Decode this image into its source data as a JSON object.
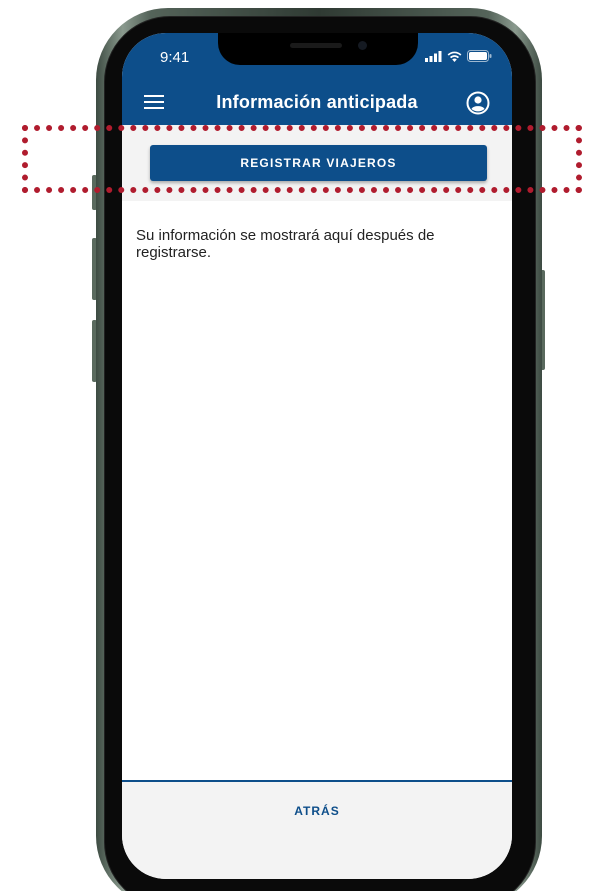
{
  "status_bar": {
    "time": "9:41",
    "signal_icon": "cellular-signal-icon",
    "wifi_icon": "wifi-icon",
    "battery_icon": "battery-icon"
  },
  "header": {
    "title": "Información anticipada",
    "menu_icon": "hamburger-menu-icon",
    "profile_icon": "user-profile-icon"
  },
  "main": {
    "register_button_label": "REGISTRAR VIAJEROS",
    "info_text": "Su información se mostrará aquí después de registrarse."
  },
  "footer": {
    "back_button_label": "ATRÁS"
  },
  "colors": {
    "primary_blue": "#0d4e8a",
    "highlight_red": "#b01c2e",
    "panel_gray": "#f3f3f3"
  }
}
